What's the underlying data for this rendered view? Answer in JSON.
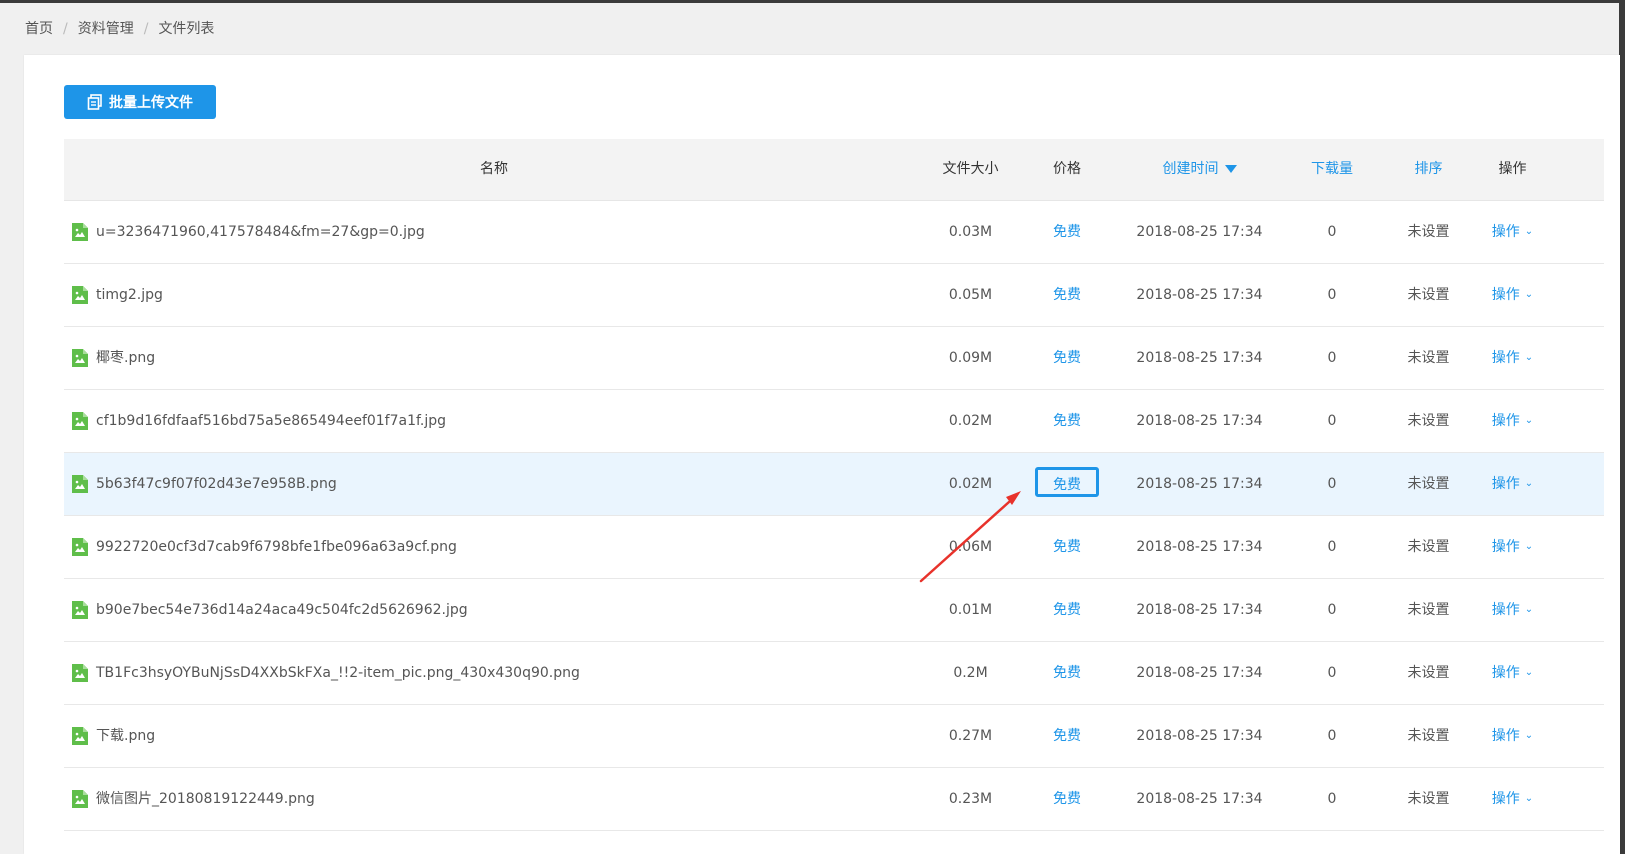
{
  "breadcrumb": [
    "首页",
    "资料管理",
    "文件列表"
  ],
  "upload_button": {
    "label": "批量上传文件",
    "icon": "copy-icon"
  },
  "table": {
    "headers": {
      "name": "名称",
      "size": "文件大小",
      "price": "价格",
      "created": "创建时间",
      "downloads": "下载量",
      "sort": "排序",
      "actions": "操作"
    },
    "rows": [
      {
        "name": "u=3236471960,417578484&fm=27&gp=0.jpg",
        "size": "0.03M",
        "price": "免费",
        "created": "2018-08-25 17:34",
        "downloads": "0",
        "sort": "未设置",
        "action": "操作"
      },
      {
        "name": "timg2.jpg",
        "size": "0.05M",
        "price": "免费",
        "created": "2018-08-25 17:34",
        "downloads": "0",
        "sort": "未设置",
        "action": "操作"
      },
      {
        "name": "椰枣.png",
        "size": "0.09M",
        "price": "免费",
        "created": "2018-08-25 17:34",
        "downloads": "0",
        "sort": "未设置",
        "action": "操作"
      },
      {
        "name": "cf1b9d16fdfaaf516bd75a5e865494eef01f7a1f.jpg",
        "size": "0.02M",
        "price": "免费",
        "created": "2018-08-25 17:34",
        "downloads": "0",
        "sort": "未设置",
        "action": "操作"
      },
      {
        "name": "5b63f47c9f07f02d43e7e958B.png",
        "size": "0.02M",
        "price": "免费",
        "created": "2018-08-25 17:34",
        "downloads": "0",
        "sort": "未设置",
        "action": "操作"
      },
      {
        "name": "9922720e0cf3d7cab9f6798bfe1fbe096a63a9cf.png",
        "size": "0.06M",
        "price": "免费",
        "created": "2018-08-25 17:34",
        "downloads": "0",
        "sort": "未设置",
        "action": "操作"
      },
      {
        "name": "b90e7bec54e736d14a24aca49c504fc2d5626962.jpg",
        "size": "0.01M",
        "price": "免费",
        "created": "2018-08-25 17:34",
        "downloads": "0",
        "sort": "未设置",
        "action": "操作"
      },
      {
        "name": "TB1Fc3hsyOYBuNjSsD4XXbSkFXa_!!2-item_pic.png_430x430q90.png",
        "size": "0.2M",
        "price": "免费",
        "created": "2018-08-25 17:34",
        "downloads": "0",
        "sort": "未设置",
        "action": "操作"
      },
      {
        "name": "下载.png",
        "size": "0.27M",
        "price": "免费",
        "created": "2018-08-25 17:34",
        "downloads": "0",
        "sort": "未设置",
        "action": "操作"
      },
      {
        "name": "微信图片_20180819122449.png",
        "size": "0.23M",
        "price": "免费",
        "created": "2018-08-25 17:34",
        "downloads": "0",
        "sort": "未设置",
        "action": "操作"
      }
    ]
  },
  "colors": {
    "accent": "#1e95e8",
    "file_icon": "#5fbe4a",
    "annotation_arrow": "#e8322b",
    "hover_row": "#eaf5fe"
  }
}
